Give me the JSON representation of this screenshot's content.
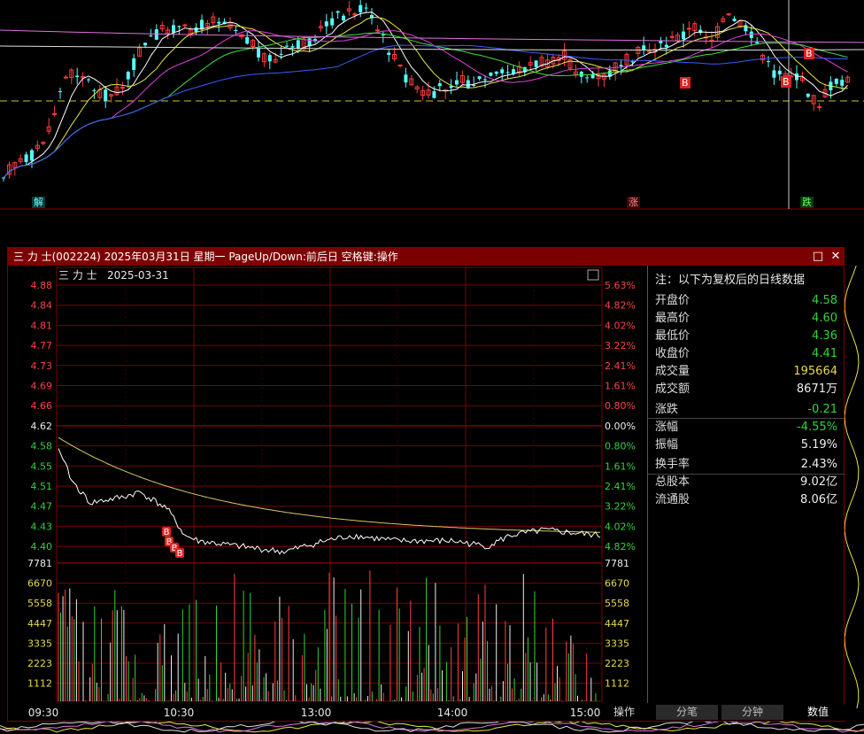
{
  "kline_markers": {
    "unlock": "解",
    "limit_up": "涨",
    "limit_down": "跌",
    "buy_left": "B",
    "buy_right": "B",
    "sell_right": "B"
  },
  "window": {
    "title": "三 力 士(002224) 2025年03月31日 星期一 PageUp/Down:前后日 空格键:操作",
    "maximize_icon": "□",
    "close_icon": "✕"
  },
  "intraday": {
    "stock_label": "三 力 士",
    "date_label": "2025-03-31",
    "prev_close": 4.62,
    "price_ticks": [
      "4.88",
      "4.84",
      "4.81",
      "4.77",
      "4.73",
      "4.69",
      "4.66",
      "4.62",
      "4.58",
      "4.55",
      "4.51",
      "4.47",
      "4.43",
      "4.40"
    ],
    "pct_ticks": [
      "5.63%",
      "4.82%",
      "4.02%",
      "3.22%",
      "2.41%",
      "1.61%",
      "0.80%",
      "0.00%",
      "0.80%",
      "1.61%",
      "2.41%",
      "3.22%",
      "4.02%",
      "4.82%"
    ],
    "volume_ticks": [
      "7781",
      "6670",
      "5558",
      "4447",
      "3335",
      "2223",
      "1112"
    ],
    "time_labels": [
      "09:30",
      "10:30",
      "13:00",
      "14:00",
      "15:00"
    ],
    "buy_marker": "B",
    "colors": {
      "up": "#ff4040",
      "down": "#33d33a",
      "flat": "#eeeeee",
      "price_line": "#ffffff",
      "avg_line": "#d8c860",
      "grid": "#7a0000"
    }
  },
  "info": {
    "header": "注：以下为复权后的日线数据",
    "rows": [
      {
        "label": "开盘价",
        "value": "4.58",
        "tone": "green"
      },
      {
        "label": "最高价",
        "value": "4.60",
        "tone": "green"
      },
      {
        "label": "最低价",
        "value": "4.36",
        "tone": "green"
      },
      {
        "label": "收盘价",
        "value": "4.41",
        "tone": "green"
      },
      {
        "label": "成交量",
        "value": "195664",
        "tone": "yellow"
      },
      {
        "label": "成交额",
        "value": "8671万",
        "tone": "white"
      },
      {
        "label": "涨跌",
        "value": "-0.21",
        "tone": "green"
      },
      {
        "label": "涨幅",
        "value": "-4.55%",
        "tone": "green"
      },
      {
        "label": "振幅",
        "value": "5.19%",
        "tone": "white"
      },
      {
        "label": "换手率",
        "value": "2.43%",
        "tone": "white"
      },
      {
        "label": "总股本",
        "value": "9.02亿",
        "tone": "white"
      },
      {
        "label": "流通股",
        "value": "8.06亿",
        "tone": "white"
      }
    ]
  },
  "tabs": {
    "op": "操作",
    "fenbi": "分笔",
    "fenzhong": "分钟",
    "shuju": "数值"
  }
}
